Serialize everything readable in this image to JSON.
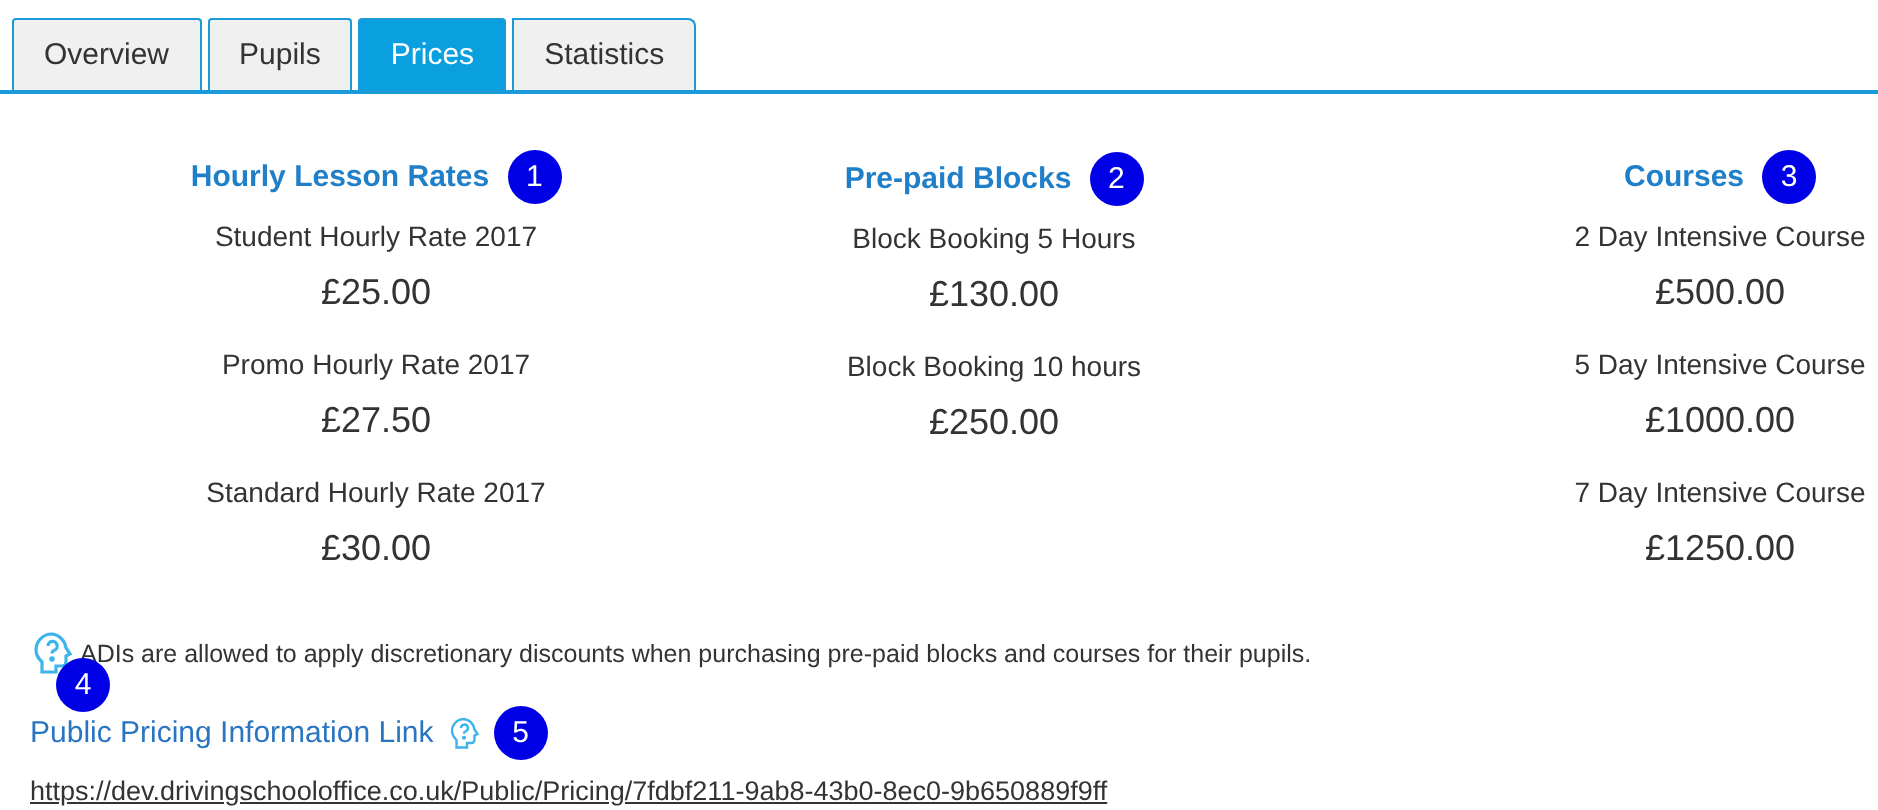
{
  "tabs": [
    {
      "label": "Overview",
      "selected": false
    },
    {
      "label": "Pupils",
      "selected": false
    },
    {
      "label": "Prices",
      "selected": true
    },
    {
      "label": "Statistics",
      "selected": false
    }
  ],
  "columns": [
    {
      "title": "Hourly Lesson Rates",
      "marker": "1",
      "items": [
        {
          "label": "Student Hourly Rate 2017",
          "price": "£25.00"
        },
        {
          "label": "Promo Hourly Rate 2017",
          "price": "£27.50"
        },
        {
          "label": "Standard Hourly Rate 2017",
          "price": "£30.00"
        }
      ]
    },
    {
      "title": "Pre-paid Blocks",
      "marker": "2",
      "items": [
        {
          "label": "Block Booking 5 Hours",
          "price": "£130.00"
        },
        {
          "label": "Block Booking 10 hours",
          "price": "£250.00"
        }
      ]
    },
    {
      "title": "Courses",
      "marker": "3",
      "items": [
        {
          "label": "2 Day Intensive Course",
          "price": "£500.00"
        },
        {
          "label": "5 Day Intensive Course",
          "price": "£1000.00"
        },
        {
          "label": "7 Day Intensive Course",
          "price": "£1250.00"
        }
      ]
    }
  ],
  "note": {
    "text": "ADIs are allowed to apply discretionary discounts when purchasing pre-paid blocks and courses for their pupils.",
    "marker": "4"
  },
  "public_link": {
    "title": "Public Pricing Information Link",
    "marker": "5",
    "url": "https://dev.drivingschooloffice.co.uk/Public/Pricing/7fdbf211-9ab8-43b0-8ec0-9b650889f9ff"
  }
}
